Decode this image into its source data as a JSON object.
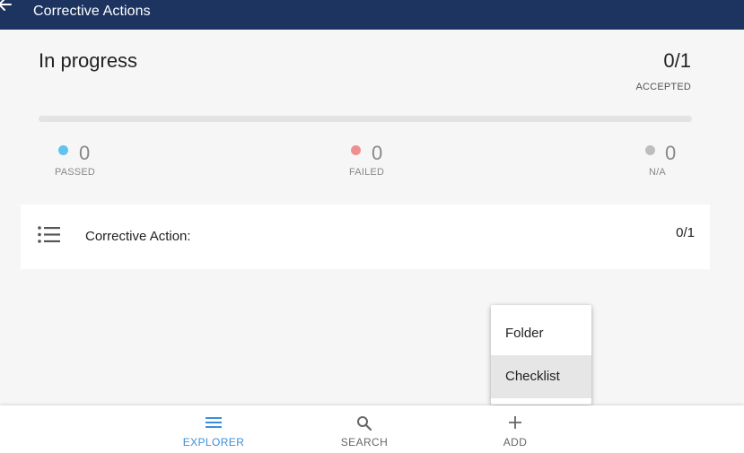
{
  "header": {
    "title": "Corrective Actions"
  },
  "summary": {
    "status": "In progress",
    "ratio": "0/1",
    "ratio_caption": "ACCEPTED",
    "progress_fraction": 0
  },
  "stats": [
    {
      "value": "0",
      "label": "PASSED",
      "color": "#5ec3ee"
    },
    {
      "value": "0",
      "label": "FAILED",
      "color": "#f08f8f"
    },
    {
      "value": "0",
      "label": "N/A",
      "color": "#bdbdbd"
    }
  ],
  "item": {
    "label": "Corrective Action:",
    "count": "0/1",
    "icon": "list-icon"
  },
  "menu": {
    "items": [
      "Folder",
      "Checklist"
    ],
    "highlighted": "Checklist"
  },
  "bottom_nav": {
    "tabs": [
      {
        "label": "EXPLORER",
        "icon": "menu-icon",
        "active": true
      },
      {
        "label": "SEARCH",
        "icon": "search-icon",
        "active": false
      },
      {
        "label": "ADD",
        "icon": "plus-icon",
        "active": false
      }
    ],
    "active_color": "#3b8fd6",
    "inactive_color": "#666666"
  },
  "colors": {
    "header_bg": "#1d3461",
    "page_bg": "#f6f6f6"
  }
}
